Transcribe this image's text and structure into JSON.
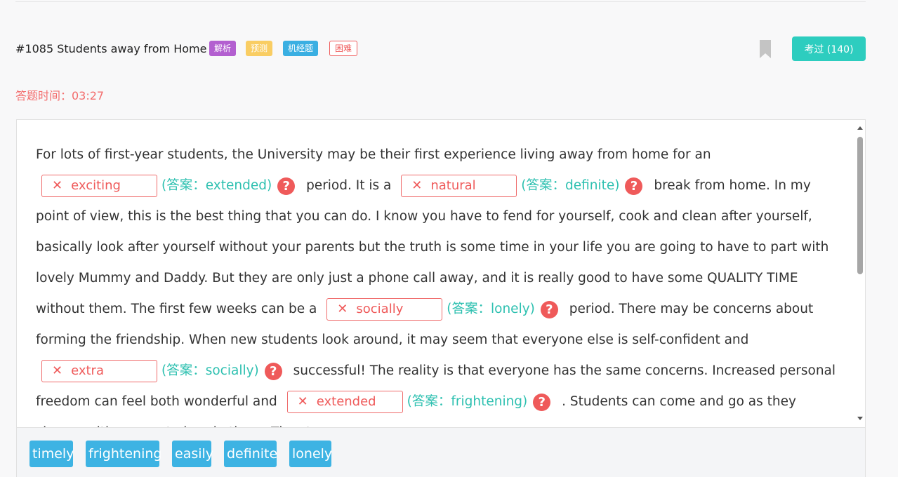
{
  "header": {
    "title": "#1085 Students away from Home",
    "tags": [
      "解析",
      "预测",
      "机经题",
      "困难"
    ],
    "exam_button": "考过 (140)"
  },
  "timer": "答题时间：03:27",
  "passage": {
    "seg1": "For lots of first-year students, the University may be their first experience living away from home for an",
    "blank1": {
      "value": "exciting",
      "answer": "(答案：extended)"
    },
    "seg2": "period. It is a",
    "blank2": {
      "value": "natural",
      "answer": "(答案：definite)"
    },
    "seg3": "break from home. In my point of view, this is the best thing that you can do. I know you have to fend for yourself, cook and clean after yourself, basically look after yourself without your parents but the truth is some time in your life you are going to have to part with lovely Mummy and Daddy. But they are only just a phone call away, and it is really good to have some QUALITY TIME without them. The first few weeks can be a",
    "blank3": {
      "value": "socially",
      "answer": "(答案：lonely)"
    },
    "seg4": "period. There may be concerns about forming the friendship. When new students look around, it may seem that everyone else is self-confident and",
    "blank4": {
      "value": "extra",
      "answer": "(答案：socially)"
    },
    "seg5": "successful! The reality is that everyone has the same concerns. Increased personal freedom can feel both wonderful and",
    "blank5": {
      "value": "extended",
      "answer": "(答案：frightening)"
    },
    "seg6": ". Students can come and go as they choose with no one to hassle them. The strange"
  },
  "wrong_mark": "✕",
  "help_mark": "?",
  "word_bank": [
    "timely",
    "frightening",
    "easily",
    "definite",
    "lonely"
  ],
  "colors": {
    "accent": "#2dcdbf",
    "error": "#ef5a5a",
    "chip": "#3db3e3"
  }
}
